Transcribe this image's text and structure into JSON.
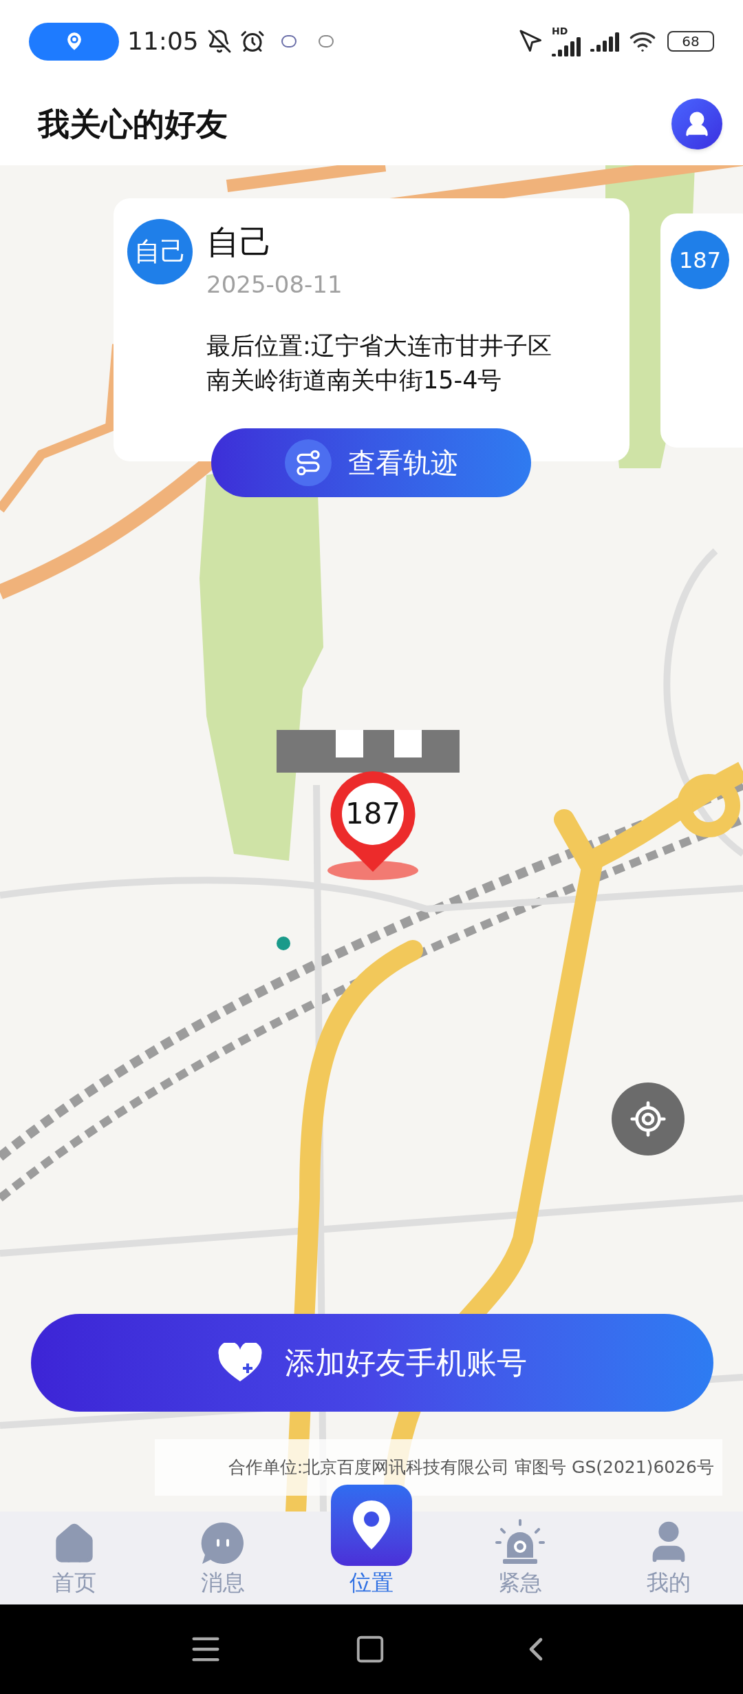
{
  "status_bar": {
    "time": "11:05",
    "network_label": "HD",
    "battery": "68"
  },
  "header": {
    "title": "我关心的好友"
  },
  "friend_cards": [
    {
      "avatar": "自己",
      "name": "自己",
      "date": "2025-08-11",
      "address": "最后位置:辽宁省大连市甘井子区南关岭街道南关中街15-4号",
      "button": "查看轨迹"
    },
    {
      "avatar": "187"
    }
  ],
  "map": {
    "pin_label": "187",
    "attribution": "合作单位:北京百度网讯科技有限公司 审图号 GS(2021)6026号"
  },
  "add_button": {
    "label": "添加好友手机账号"
  },
  "bottom_nav": [
    {
      "kind": "home",
      "label": "首页",
      "selected": false
    },
    {
      "kind": "message",
      "label": "消息",
      "selected": false
    },
    {
      "kind": "location",
      "label": "位置",
      "selected": true
    },
    {
      "kind": "alarm",
      "label": "紧急",
      "selected": false
    },
    {
      "kind": "profile",
      "label": "我的",
      "selected": false
    }
  ]
}
